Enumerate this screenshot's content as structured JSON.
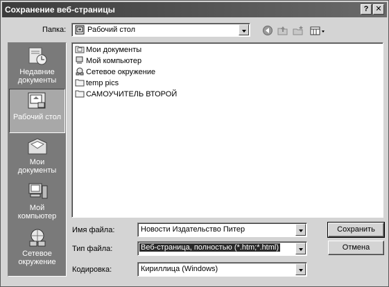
{
  "window": {
    "title": "Сохранение веб-страницы",
    "help_label": "?",
    "close_label": "✕"
  },
  "location": {
    "label": "Папка:",
    "value": "Рабочий стол"
  },
  "toolbar": {
    "icons": [
      "back-icon",
      "up-folder-icon",
      "new-folder-icon",
      "view-menu-icon"
    ]
  },
  "places": [
    {
      "label_line1": "Недавние",
      "label_line2": "документы",
      "icon": "recent-documents-icon"
    },
    {
      "label_line1": "Рабочий стол",
      "label_line2": "",
      "icon": "desktop-icon"
    },
    {
      "label_line1": "Мои",
      "label_line2": "документы",
      "icon": "my-documents-icon"
    },
    {
      "label_line1": "Мой",
      "label_line2": "компьютер",
      "icon": "my-computer-icon"
    },
    {
      "label_line1": "Сетевое",
      "label_line2": "окружение",
      "icon": "network-icon"
    }
  ],
  "files": [
    {
      "name": "Мои документы",
      "icon": "documents-folder-icon"
    },
    {
      "name": "Мой компьютер",
      "icon": "computer-icon"
    },
    {
      "name": "Сетевое окружение",
      "icon": "network-icon"
    },
    {
      "name": "temp pics",
      "icon": "folder-icon"
    },
    {
      "name": "САМОУЧИТЕЛЬ ВТОРОЙ",
      "icon": "folder-icon"
    }
  ],
  "form": {
    "filename_label": "Имя файла:",
    "filename_value": "Новости  Издательство Питер",
    "filetype_label": "Тип файла:",
    "filetype_value": "Веб-страница, полностью (*.htm;*.html)",
    "encoding_label": "Кодировка:",
    "encoding_value": "Кириллица (Windows)"
  },
  "buttons": {
    "save": "Сохранить",
    "cancel": "Отмена"
  }
}
